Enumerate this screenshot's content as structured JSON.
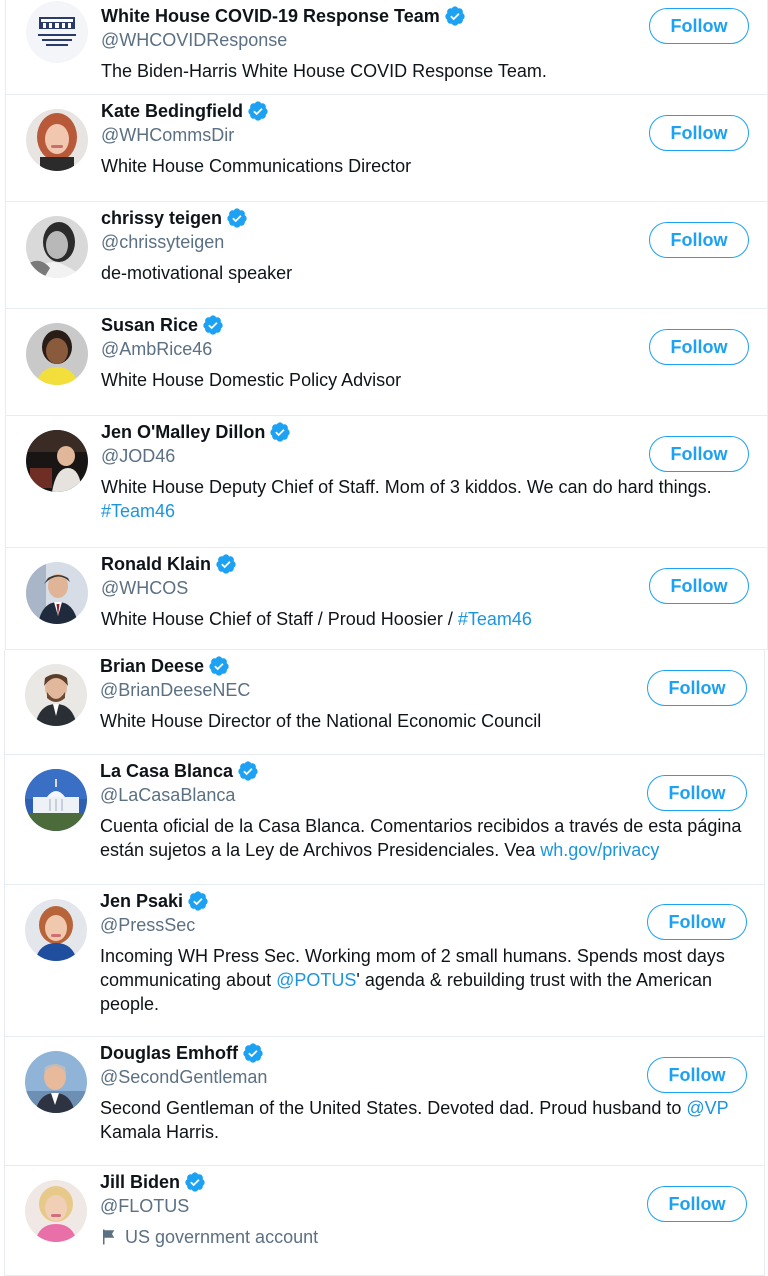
{
  "accent_color": "#1da1f2",
  "link_color": "#1b95e0",
  "verified_icon": "verified-badge-icon",
  "users": [
    {
      "name": "White House COVID-19 Response Team",
      "handle": "@WHCOVIDResponse",
      "verified": true,
      "follow_label": "Follow",
      "avatar": "white-house-covid-logo",
      "bio": [
        {
          "text": "The Biden-Harris White House COVID Response Team."
        }
      ]
    },
    {
      "name": "Kate Bedingfield",
      "handle": "@WHCommsDir",
      "verified": true,
      "follow_label": "Follow",
      "avatar": "portrait-red-hair",
      "bio": [
        {
          "text": "White House Communications Director"
        }
      ]
    },
    {
      "name": "chrissy teigen",
      "handle": "@chrissyteigen",
      "verified": true,
      "follow_label": "Follow",
      "avatar": "portrait-black-white",
      "bio": [
        {
          "text": "de-motivational speaker"
        }
      ]
    },
    {
      "name": "Susan Rice",
      "handle": "@AmbRice46",
      "verified": true,
      "follow_label": "Follow",
      "avatar": "portrait-yellow-top",
      "bio": [
        {
          "text": "White House Domestic Policy Advisor"
        }
      ]
    },
    {
      "name": "Jen O'Malley Dillon",
      "handle": "@JOD46",
      "verified": true,
      "follow_label": "Follow",
      "avatar": "portrait-stage",
      "bio": [
        {
          "text": "White House Deputy Chief of Staff. Mom of 3 kiddos. We can do hard things. "
        },
        {
          "text": "#Team46",
          "link": true
        }
      ]
    },
    {
      "name": "Ronald Klain",
      "handle": "@WHCOS",
      "verified": true,
      "follow_label": "Follow",
      "avatar": "portrait-suit-flag",
      "bio": [
        {
          "text": "White House Chief of Staff / Proud Hoosier / "
        },
        {
          "text": "#Team46",
          "link": true
        }
      ]
    },
    {
      "name": "Brian Deese",
      "handle": "@BrianDeeseNEC",
      "verified": true,
      "follow_label": "Follow",
      "avatar": "portrait-suit-beard",
      "bio": [
        {
          "text": "White House Director of the National Economic Council"
        }
      ]
    },
    {
      "name": "La Casa Blanca",
      "handle": "@LaCasaBlanca",
      "verified": true,
      "follow_label": "Follow",
      "avatar": "white-house-building",
      "bio": [
        {
          "text": "Cuenta oficial de la Casa Blanca. Comentarios recibidos a través de esta página están sujetos a la Ley de Archivos Presidenciales. Vea "
        },
        {
          "text": "wh.gov/privacy",
          "link": true
        }
      ]
    },
    {
      "name": "Jen Psaki",
      "handle": "@PressSec",
      "verified": true,
      "follow_label": "Follow",
      "avatar": "portrait-blue-dress",
      "bio": [
        {
          "text": "Incoming WH Press Sec. Working mom of 2 small humans. Spends most days communicating about "
        },
        {
          "text": "@POTUS",
          "link": true
        },
        {
          "text": "' agenda & rebuilding trust with the American people."
        }
      ]
    },
    {
      "name": "Douglas Emhoff",
      "handle": "@SecondGentleman",
      "verified": true,
      "follow_label": "Follow",
      "avatar": "portrait-sky",
      "bio": [
        {
          "text": "Second Gentleman of the United States. Devoted dad. Proud husband to "
        },
        {
          "text": "@VP",
          "link": true
        },
        {
          "text": " Kamala Harris."
        }
      ]
    },
    {
      "name": "Jill Biden",
      "handle": "@FLOTUS",
      "verified": true,
      "follow_label": "Follow",
      "avatar": "portrait-pink",
      "gov_label": "US government account",
      "gov_icon": "flag-icon",
      "bio": []
    }
  ]
}
